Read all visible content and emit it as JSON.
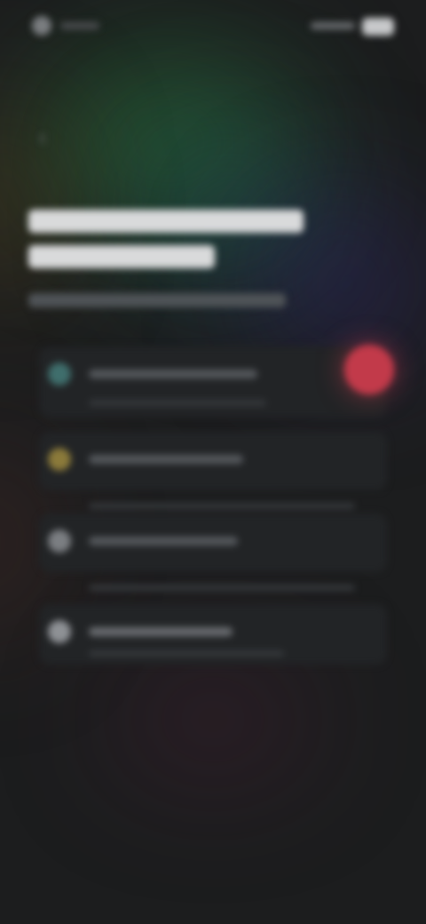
{
  "icons": {
    "back": "arrow-left-icon",
    "record": "record-button-icon"
  },
  "colors": {
    "background": "#1c1d1e",
    "accent_record": "#c23a4a",
    "card_background": "#222426",
    "headline": "#d9dadb"
  },
  "list": {
    "items": [
      {
        "icon": "item-icon-teal"
      },
      {
        "icon": "item-icon-amber"
      },
      {
        "icon": "item-icon-gray"
      },
      {
        "icon": "item-icon-light"
      }
    ]
  }
}
